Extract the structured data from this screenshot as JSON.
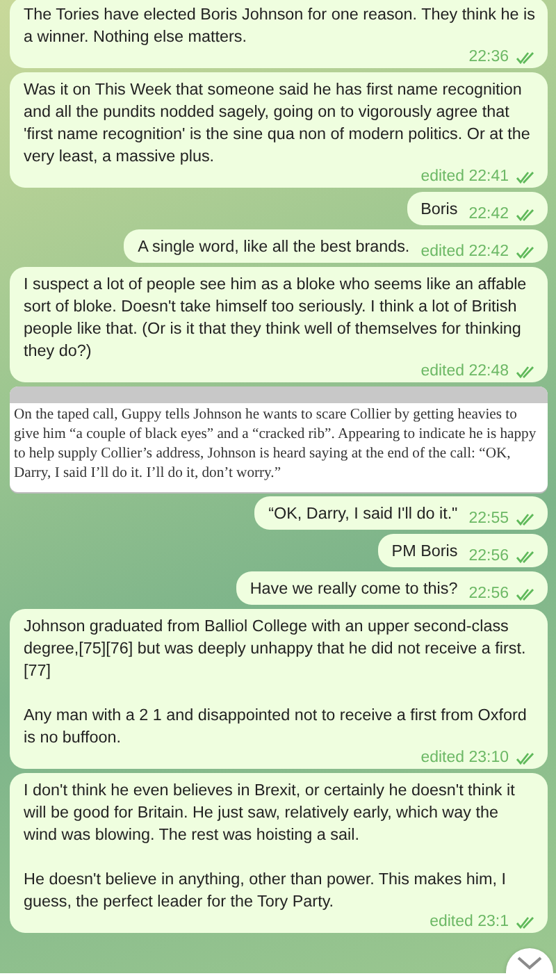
{
  "messages": [
    {
      "kind": "text",
      "paragraphs": [
        "The Tories have elected Boris Johnson for one reason. They think he is a winner. Nothing else matters."
      ],
      "time": "22:36"
    },
    {
      "kind": "text",
      "paragraphs": [
        "Was it on This Week that someone said he has first name recognition and all the pundits nodded sagely, going on to vigorously agree that 'first name recognition' is the sine qua non of modern politics. Or at the very least, a massive plus."
      ],
      "time": "edited 22:41"
    },
    {
      "kind": "text",
      "paragraphs": [
        "Boris"
      ],
      "time": "22:42"
    },
    {
      "kind": "text",
      "paragraphs": [
        "A single word, like all the best brands."
      ],
      "time": "edited 22:42"
    },
    {
      "kind": "text",
      "paragraphs": [
        "I suspect a lot of people see him as a bloke who seems like an affable sort of bloke. Doesn't take himself too seriously. I think a lot of British people like that. (Or is it that they think well of themselves for thinking they do?)"
      ],
      "time": "edited 22:48"
    },
    {
      "kind": "clipping",
      "paragraphs": [
        "On the taped call, Guppy tells Johnson he wants to scare Collier by getting heavies to give him “a couple of black eyes” and a “cracked rib”. Appearing to indicate he is happy to help supply Collier’s address, Johnson is heard saying at the end of the call: “OK, Darry, I said I’ll do it. I’ll do it, don’t worry.”"
      ]
    },
    {
      "kind": "text",
      "paragraphs": [
        "“OK, Darry, I said I'll do it.\""
      ],
      "time": "22:55"
    },
    {
      "kind": "text",
      "paragraphs": [
        "PM Boris"
      ],
      "time": "22:56"
    },
    {
      "kind": "text",
      "paragraphs": [
        "Have we really come to this?"
      ],
      "time": "22:56"
    },
    {
      "kind": "text",
      "paragraphs": [
        "Johnson graduated from Balliol College with an upper second-class degree,[75][76] but was deeply unhappy that he did not receive a first.[77]",
        "Any man with a 2 1 and disappointed not to receive a first from Oxford is no buffoon."
      ],
      "time": "edited 23:10"
    },
    {
      "kind": "text",
      "paragraphs": [
        "I don't think he even believes in Brexit, or certainly he doesn't think it will be good for Britain. He just saw, relatively early, which way the wind was blowing. The rest was hoisting a sail.",
        "He doesn't believe in anything, other than power. This makes him, I guess, the perfect leader for the Tory Party."
      ],
      "time": "edited 23:1"
    }
  ]
}
